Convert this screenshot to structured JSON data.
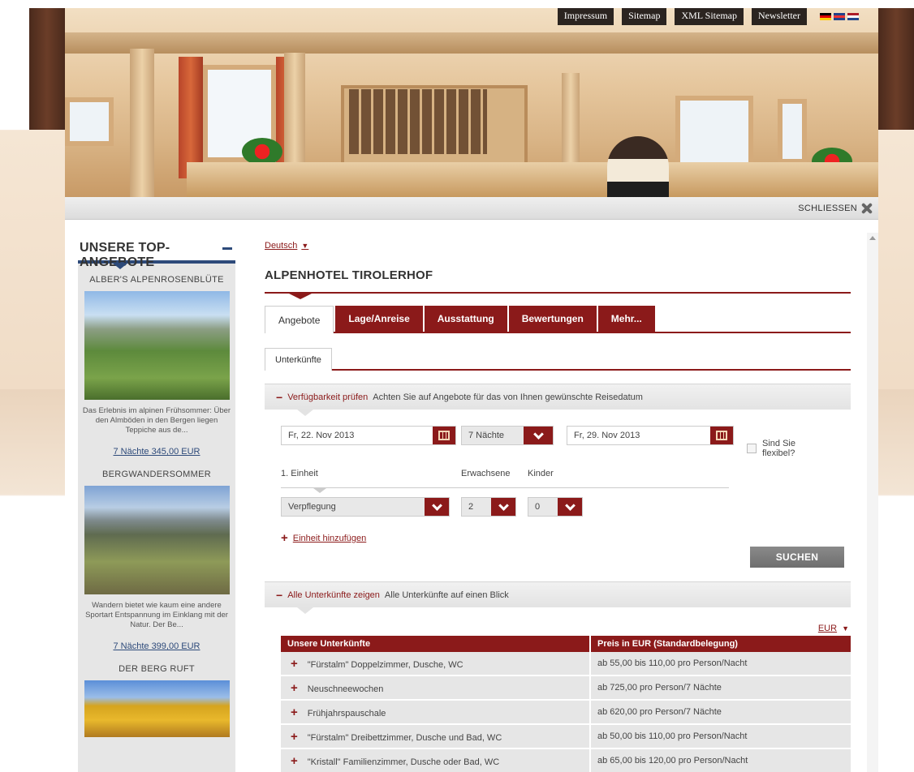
{
  "top_nav": [
    {
      "label": "Impressum"
    },
    {
      "label": "Sitemap"
    },
    {
      "label": "XML Sitemap"
    },
    {
      "label": "Newsletter"
    }
  ],
  "flags": [
    "german-flag-icon",
    "english-flag-icon",
    "dutch-flag-icon"
  ],
  "close_label": "SCHLIESSEN",
  "sidebar": {
    "title": "UNSERE TOP-ANGEBOTE",
    "offers": [
      {
        "title": "ALBER'S ALPENROSENBLÜTE",
        "desc": "Das Erlebnis im alpinen Frühsommer: Über den Almböden in den Bergen liegen Teppiche aus de...",
        "price": "7 Nächte 345,00 EUR"
      },
      {
        "title": "BERGWANDERSOMMER",
        "desc": "Wandern bietet wie kaum eine andere Sportart Entspannung im Einklang mit der Natur. Der Be...",
        "price": "7 Nächte 399,00 EUR"
      },
      {
        "title": "DER BERG RUFT"
      }
    ]
  },
  "main": {
    "language": "Deutsch",
    "hotel_name": "ALPENHOTEL TIROLERHOF",
    "tabs": [
      {
        "label": "Angebote"
      },
      {
        "label": "Lage/Anreise"
      },
      {
        "label": "Ausstattung"
      },
      {
        "label": "Bewertungen"
      },
      {
        "label": "Mehr..."
      }
    ],
    "subtab": "Unterkünfte",
    "availability": {
      "header_label": "Verfügbarkeit prüfen",
      "header_text": "Achten Sie auf Angebote für das von Ihnen gewünschte Reisedatum",
      "arrival": "Fr, 22. Nov 2013",
      "nights": "7 Nächte",
      "departure": "Fr, 29. Nov 2013",
      "flexible_label": "Sind Sie flexibel?",
      "unit_label": "1. Einheit",
      "adults_label": "Erwachsene",
      "children_label": "Kinder",
      "board": "Verpflegung",
      "adults": "2",
      "children": "0",
      "add_unit": "Einheit hinzufügen",
      "search": "SUCHEN"
    },
    "all_rooms": {
      "header_label": "Alle Unterkünfte zeigen",
      "header_text": "Alle Unterkünfte auf einen Blick"
    },
    "currency": "EUR",
    "table": {
      "headers": [
        "Unsere Unterkünfte",
        "Preis in EUR (Standardbelegung)"
      ],
      "rows": [
        {
          "name": "\"Fürstalm\" Doppelzimmer, Dusche, WC",
          "price": "ab 55,00 bis 110,00 pro Person/Nacht"
        },
        {
          "name": "Neuschneewochen",
          "price": "ab 725,00 pro Person/7 Nächte"
        },
        {
          "name": "Frühjahrspauschale",
          "price": "ab 620,00 pro Person/7 Nächte"
        },
        {
          "name": "\"Fürstalm\" Dreibettzimmer, Dusche und Bad, WC",
          "price": "ab 50,00 bis 110,00 pro Person/Nacht"
        },
        {
          "name": "\"Kristall\" Familienzimmer, Dusche oder Bad, WC",
          "price": "ab 65,00 bis 120,00 pro Person/Nacht"
        }
      ]
    }
  }
}
